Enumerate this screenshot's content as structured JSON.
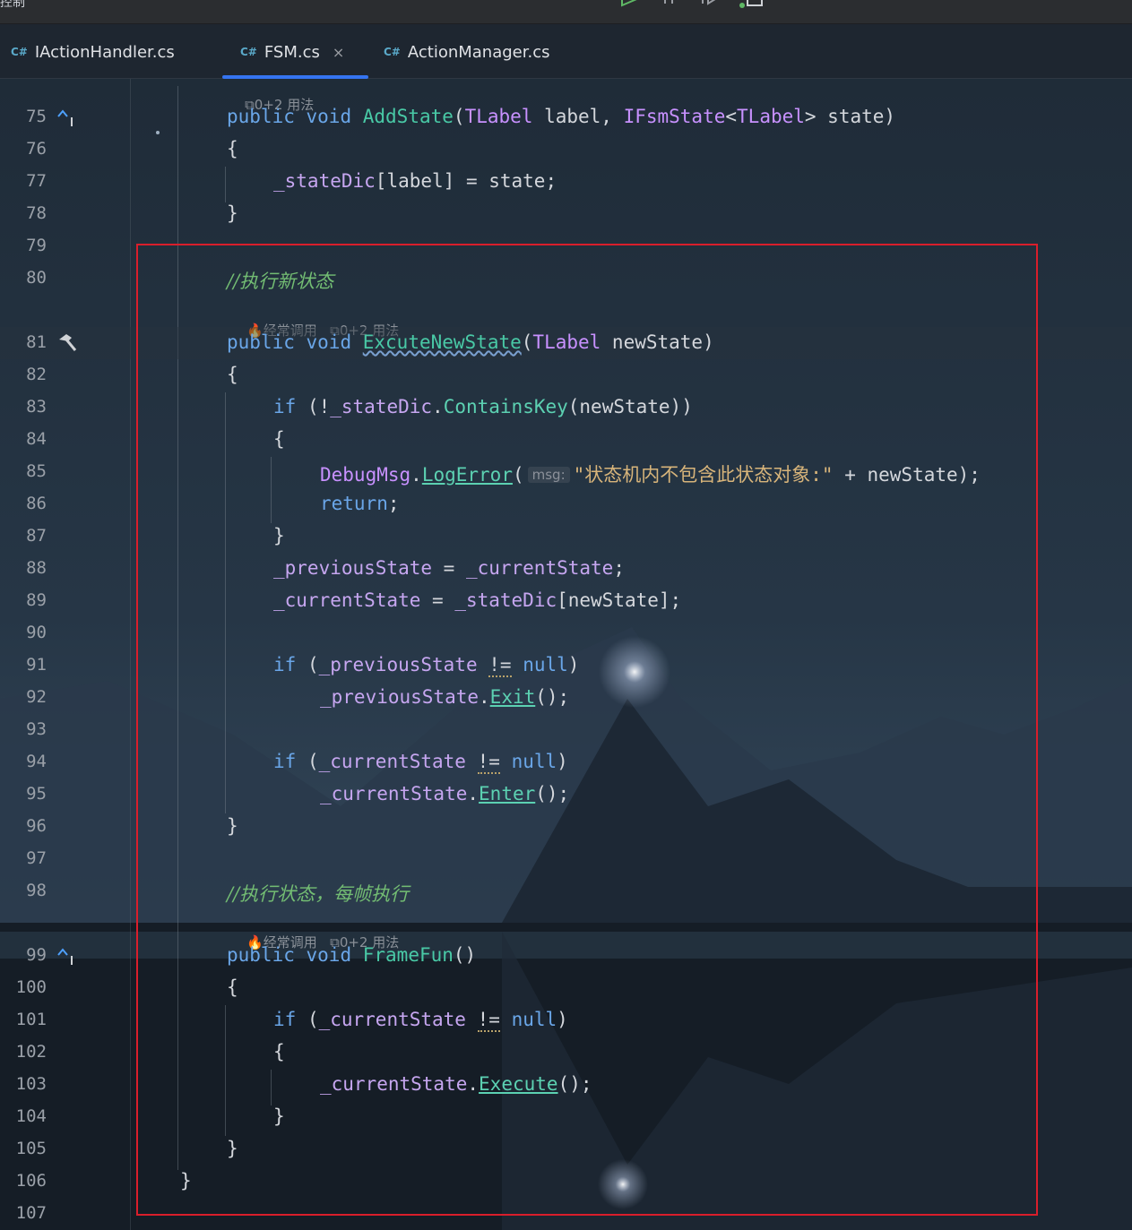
{
  "window": {
    "title_fragment": "控制"
  },
  "tabs": [
    {
      "lang": "C#",
      "label": "IActionHandler.cs",
      "active": false
    },
    {
      "lang": "C#",
      "label": "FSM.cs",
      "active": true,
      "close": "×"
    },
    {
      "lang": "C#",
      "label": "ActionManager.cs",
      "active": false
    }
  ],
  "hints": {
    "usages_top": "0+2 用法",
    "frequent_81": "经常调用",
    "usages_81": "0+2 用法",
    "frequent_99": "经常调用",
    "usages_99": "0+2 用法",
    "param_msg": "msg:"
  },
  "line_numbers": [
    "75",
    "76",
    "77",
    "78",
    "79",
    "80",
    "81",
    "82",
    "83",
    "84",
    "85",
    "86",
    "87",
    "88",
    "89",
    "90",
    "91",
    "92",
    "93",
    "94",
    "95",
    "96",
    "97",
    "98",
    "99",
    "100",
    "101",
    "102",
    "103",
    "104",
    "105",
    "106",
    "107"
  ],
  "code": {
    "l75": {
      "kw1": "public",
      "kw2": "void",
      "fn": "AddState",
      "p1": "(",
      "ty1": "TLabel",
      "t1": " label, ",
      "ty2": "IFsmState",
      "t2": "<",
      "ty3": "TLabel",
      "t3": "> state)"
    },
    "l76": "{",
    "l77": {
      "field": "_stateDic",
      "rest": "[label] = state;"
    },
    "l78": "}",
    "l80": "//执行新状态",
    "l81": {
      "kw1": "public",
      "kw2": "void",
      "fn": "ExcuteNewState",
      "p1": "(",
      "ty": "TLabel",
      "rest": " newState)"
    },
    "l82": "{",
    "l83": {
      "kw": "if",
      "t1": " (!",
      "field": "_stateDic",
      "dot": ".",
      "fn": "ContainsKey",
      "rest": "(newState))"
    },
    "l84": "{",
    "l85": {
      "ty": "DebugMsg",
      "dot": ".",
      "fn": "LogError",
      "p": "(",
      "str": "\"状态机内不包含此状态对象:\"",
      "rest": " + newState);"
    },
    "l86": {
      "kw": "return",
      "rest": ";"
    },
    "l87": "}",
    "l88": {
      "f1": "_previousState",
      "mid": " = ",
      "f2": "_currentState",
      "rest": ";"
    },
    "l89": {
      "f1": "_currentState",
      "mid": " = ",
      "f2": "_stateDic",
      "rest": "[newState];"
    },
    "l91": {
      "kw": "if",
      "t1": " (",
      "field": "_previousState",
      "sp": " ",
      "op": "!=",
      "sp2": " ",
      "kw2": "null",
      "rest": ")"
    },
    "l92": {
      "field": "_previousState",
      "dot": ".",
      "fn": "Exit",
      "rest": "();"
    },
    "l94": {
      "kw": "if",
      "t1": " (",
      "field": "_currentState",
      "sp": " ",
      "op": "!=",
      "sp2": " ",
      "kw2": "null",
      "rest": ")"
    },
    "l95": {
      "field": "_currentState",
      "dot": ".",
      "fn": "Enter",
      "rest": "();"
    },
    "l96": "}",
    "l98": "//执行状态，每帧执行",
    "l99": {
      "kw1": "public",
      "kw2": "void",
      "fn": "FrameFun",
      "rest": "()"
    },
    "l100": "{",
    "l101": {
      "kw": "if",
      "t1": " (",
      "field": "_currentState",
      "sp": " ",
      "op": "!=",
      "sp2": " ",
      "kw2": "null",
      "rest": ")"
    },
    "l102": "{",
    "l103": {
      "field": "_currentState",
      "dot": ".",
      "fn": "Execute",
      "rest": "();"
    },
    "l104": "}",
    "l105": "}",
    "l106": "}"
  },
  "colors": {
    "highlight_box": "#d91e2b",
    "active_tab_underline": "#3574f0"
  }
}
